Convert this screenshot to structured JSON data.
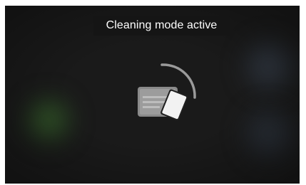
{
  "status": {
    "banner_text": "Cleaning mode active"
  },
  "icons": {
    "main": "cleaning-card-icon",
    "progress": "progress-arc-icon"
  },
  "colors": {
    "background": "#1a1a1a",
    "banner_background": "#151515",
    "banner_text": "#ffffff",
    "icon_light": "#f2f2f2",
    "icon_gray": "#8a8a8a",
    "arc": "#9a9a9a"
  }
}
